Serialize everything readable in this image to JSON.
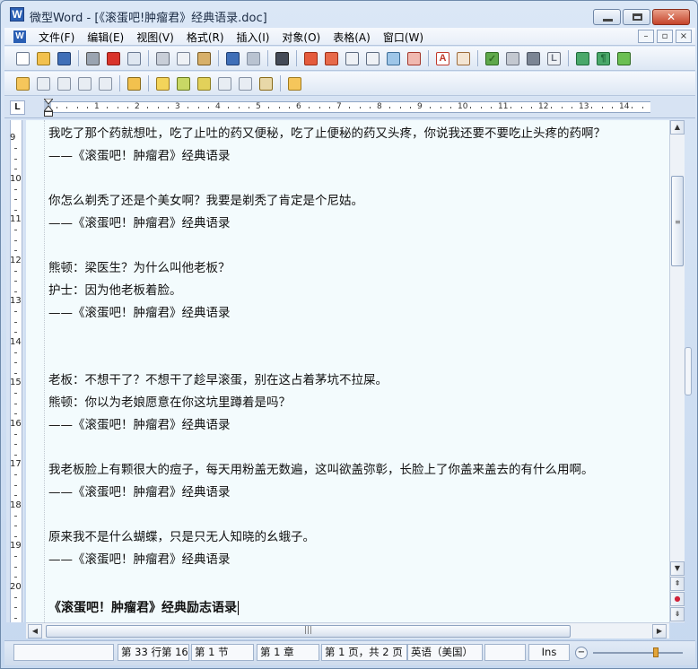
{
  "window": {
    "title": "微型Word - [《滚蛋吧!肿瘤君》经典语录.doc]",
    "app_icon": "W"
  },
  "menu": {
    "items": [
      "文件(F)",
      "编辑(E)",
      "视图(V)",
      "格式(R)",
      "插入(I)",
      "对象(O)",
      "表格(A)",
      "窗口(W)"
    ],
    "mdi_buttons": [
      "–",
      "▫",
      "×"
    ]
  },
  "toolbar1": {
    "icons": [
      {
        "name": "new-document-icon",
        "color": "#ffffff",
        "border": "#6c7a90"
      },
      {
        "name": "open-folder-icon",
        "color": "#f2c14e",
        "border": "#9c7a1d"
      },
      {
        "name": "save-icon",
        "color": "#3f6fb8",
        "border": "#1f3e72"
      },
      {
        "sep": true
      },
      {
        "name": "print-icon",
        "color": "#9aa4b1",
        "border": "#555"
      },
      {
        "name": "pdf-icon",
        "color": "#d9342b",
        "border": "#8d1c16"
      },
      {
        "name": "print-preview-icon",
        "color": "#dfe7f1",
        "border": "#6a7a93"
      },
      {
        "sep": true
      },
      {
        "name": "cut-icon",
        "color": "#c8ced8",
        "border": "#6b7280"
      },
      {
        "name": "copy-icon",
        "color": "#eef1f5",
        "border": "#7a8597"
      },
      {
        "name": "paste-icon",
        "color": "#d7b06a",
        "border": "#7a5a22"
      },
      {
        "sep": true
      },
      {
        "name": "undo-icon",
        "color": "#3f6fb8",
        "border": "#1f3e72"
      },
      {
        "name": "redo-icon",
        "color": "#b9c3d1",
        "border": "#8591a3"
      },
      {
        "sep": true
      },
      {
        "name": "find-icon",
        "color": "#444b57",
        "border": "#222"
      },
      {
        "sep": true
      },
      {
        "name": "insert-table-icon",
        "color": "#e45b3c",
        "border": "#9d2e16"
      },
      {
        "name": "table-properties-icon",
        "color": "#e76a4a",
        "border": "#9d2e16"
      },
      {
        "name": "text-box-icon",
        "color": "#eef1f5",
        "border": "#5d6b80"
      },
      {
        "name": "columns-icon",
        "color": "#eef1f5",
        "border": "#5d6b80"
      },
      {
        "name": "zoom-icon",
        "color": "#9ec6e8",
        "border": "#3c6d97"
      },
      {
        "name": "zoom-percent-icon",
        "color": "#f0b9b0",
        "border": "#a3362a"
      },
      {
        "sep": true
      },
      {
        "name": "font-color-icon",
        "color": "#ffffff",
        "border": "#c0392b",
        "text": "A"
      },
      {
        "name": "page-setup-icon",
        "color": "#f3e5d3",
        "border": "#9c6b3a"
      },
      {
        "sep": true
      },
      {
        "name": "spell-check-icon",
        "color": "#5fa84b",
        "border": "#2f6a22",
        "text": "✓"
      },
      {
        "name": "statistics-icon",
        "color": "#c3c8d0",
        "border": "#6b7280"
      },
      {
        "name": "shading-icon",
        "color": "#7b8594",
        "border": "#4a5260"
      },
      {
        "name": "style-icon",
        "color": "#eef1f5",
        "border": "#6b7280",
        "text": "L"
      },
      {
        "sep": true
      },
      {
        "name": "bookmark-icon",
        "color": "#4aa86a",
        "border": "#1f6a3a"
      },
      {
        "name": "paragraph-mark-icon",
        "color": "#4aa86a",
        "border": "#1f6a3a",
        "text": "¶"
      },
      {
        "name": "track-changes-icon",
        "color": "#6bbf53",
        "border": "#2f6a22"
      }
    ]
  },
  "toolbar2": {
    "icons": [
      {
        "name": "new-comment-icon",
        "color": "#f5c65b",
        "border": "#a07a1e"
      },
      {
        "name": "edit-comment-icon",
        "color": "#e8edf3",
        "border": "#8591a3"
      },
      {
        "name": "delete-comment-icon",
        "color": "#e8edf3",
        "border": "#8591a3"
      },
      {
        "name": "previous-comment-icon",
        "color": "#e8edf3",
        "border": "#8591a3"
      },
      {
        "name": "next-comment-icon",
        "color": "#e8edf3",
        "border": "#8591a3"
      },
      {
        "sep": true
      },
      {
        "name": "review-panel-icon",
        "color": "#f2c14e",
        "border": "#8a6a18"
      },
      {
        "sep": true
      },
      {
        "name": "accept-change-icon",
        "color": "#f3d45a",
        "border": "#9c7a1d"
      },
      {
        "name": "reject-change-icon",
        "color": "#c8d865",
        "border": "#6a7a1d"
      },
      {
        "name": "accept-all-icon",
        "color": "#e2d15a",
        "border": "#8d7d1d"
      },
      {
        "name": "previous-change-icon",
        "color": "#e8edf3",
        "border": "#8591a3"
      },
      {
        "name": "next-change-icon",
        "color": "#e8edf3",
        "border": "#8591a3"
      },
      {
        "name": "review-settings-icon",
        "color": "#e8d8a8",
        "border": "#8a6a18"
      },
      {
        "sep": true
      },
      {
        "name": "highlight-changes-icon",
        "color": "#f5c65b",
        "border": "#a07a1e"
      }
    ]
  },
  "ruler": {
    "corner_label": "L",
    "numbers": [
      "1",
      "2",
      "3",
      "4",
      "5",
      "6",
      "7",
      "8",
      "9",
      "10",
      "11",
      "12",
      "13",
      "14"
    ]
  },
  "vertical_ruler": {
    "numbers": [
      "9",
      "10",
      "11",
      "12",
      "13",
      "14",
      "15",
      "16",
      "17",
      "18",
      "19",
      "20"
    ]
  },
  "document": {
    "lines": [
      "我吃了那个药就想吐，吃了止吐的药又便秘，吃了止便秘的药又头疼，你说我还要不要吃止头疼的药啊？",
      "——《滚蛋吧！肿瘤君》经典语录",
      "",
      "你怎么剃秃了还是个美女啊？我要是剃秃了肯定是个尼姑。",
      "——《滚蛋吧！肿瘤君》经典语录",
      "",
      "熊顿：梁医生？为什么叫他老板？",
      "护士：因为他老板着脸。",
      "——《滚蛋吧！肿瘤君》经典语录",
      "",
      "",
      "老板：不想干了？不想干了趁早滚蛋，别在这占着茅坑不拉屎。",
      "熊顿：你以为老娘愿意在你这坑里蹲着是吗？",
      "——《滚蛋吧！肿瘤君》经典语录",
      "",
      "我老板脸上有颗很大的痘子，每天用粉盖无数遍，这叫欲盖弥彰，长脸上了你盖来盖去的有什么用啊。",
      "——《滚蛋吧！肿瘤君》经典语录",
      "",
      "原来我不是什么蝴蝶，只是只无人知晓的幺蛾子。",
      "——《滚蛋吧！肿瘤君》经典语录",
      "",
      "《滚蛋吧！肿瘤君》经典励志语录"
    ]
  },
  "statusbar": {
    "position": "第 33 行第 16",
    "section": "第 1 节",
    "chapter": "第 1 章",
    "page": "第 1 页，共 2 页",
    "language": "英语（美国）",
    "mode": "Ins"
  },
  "scroll": {
    "up": "▲",
    "down": "▼",
    "left": "◀",
    "right": "▶",
    "prev_page": "⇞",
    "browse": "●",
    "next_page": "⇟",
    "grip": "|||"
  },
  "zoom": {
    "minus": "−",
    "level_fraction": 0.7
  }
}
